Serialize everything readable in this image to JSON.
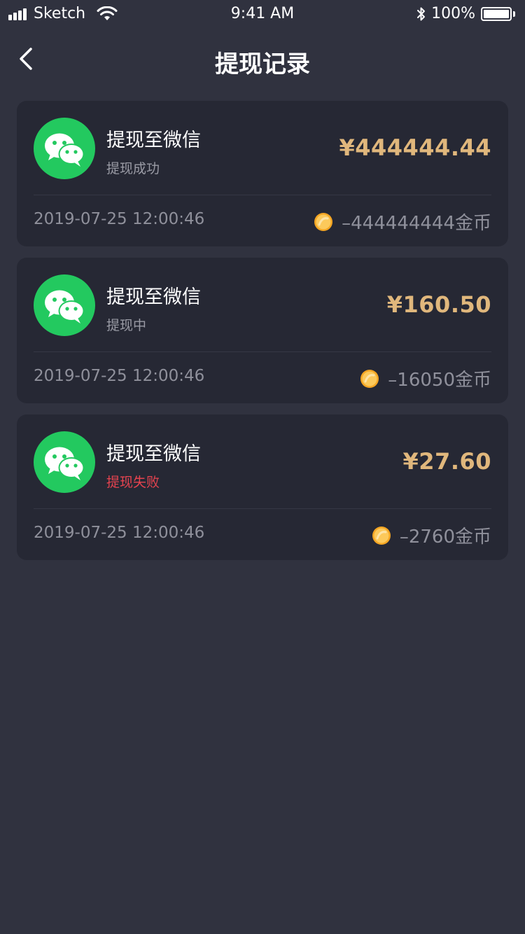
{
  "status_bar": {
    "carrier": "Sketch",
    "time": "9:41 AM",
    "battery_percent": "100%",
    "battery_level": 1.0,
    "icons": [
      "signal-icon",
      "wifi-icon",
      "bluetooth-icon",
      "battery-icon"
    ]
  },
  "nav": {
    "back_icon": "chevron-left-icon",
    "title": "提现记录"
  },
  "colors": {
    "background": "#30323f",
    "card": "#262834",
    "amount": "#e0b77c",
    "wechat_green": "#23c95f",
    "failed_red": "#e5434f",
    "muted_text": "#8f909b"
  },
  "records": [
    {
      "icon": "wechat-icon",
      "title": "提现至微信",
      "status": "提现成功",
      "status_type": "success",
      "amount": "¥444444.44",
      "time": "2019-07-25 12:00:46",
      "coin_icon": "gold-coin-icon",
      "coins": "–444444444金币"
    },
    {
      "icon": "wechat-icon",
      "title": "提现至微信",
      "status": "提现中",
      "status_type": "pending",
      "amount": "¥160.50",
      "time": "2019-07-25 12:00:46",
      "coin_icon": "gold-coin-icon",
      "coins": "–16050金币"
    },
    {
      "icon": "wechat-icon",
      "title": "提现至微信",
      "status": "提现失败",
      "status_type": "failed",
      "amount": "¥27.60",
      "time": "2019-07-25 12:00:46",
      "coin_icon": "gold-coin-icon",
      "coins": "–2760金币"
    }
  ]
}
